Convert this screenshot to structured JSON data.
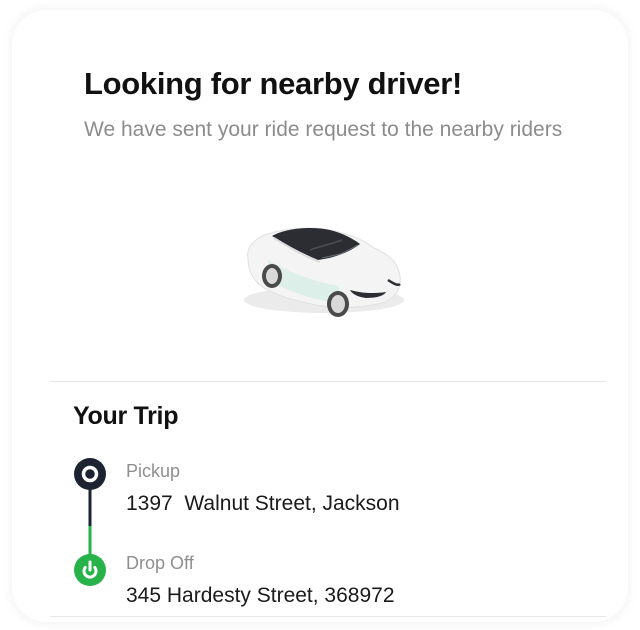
{
  "header": {
    "title": "Looking for nearby driver!",
    "subtitle": "We have sent your ride request to the nearby riders"
  },
  "illustration": {
    "icon": "car-icon",
    "body_color": "#f4f4f4",
    "window_color": "#2b2d33"
  },
  "trip": {
    "title": "Your Trip",
    "pickup": {
      "label": "Pickup",
      "address": "1397  Walnut Street, Jackson",
      "marker_color": "#1d2330"
    },
    "dropoff": {
      "label": "Drop Off",
      "address": "345 Hardesty Street, 368972",
      "marker_color": "#27b34a"
    }
  }
}
